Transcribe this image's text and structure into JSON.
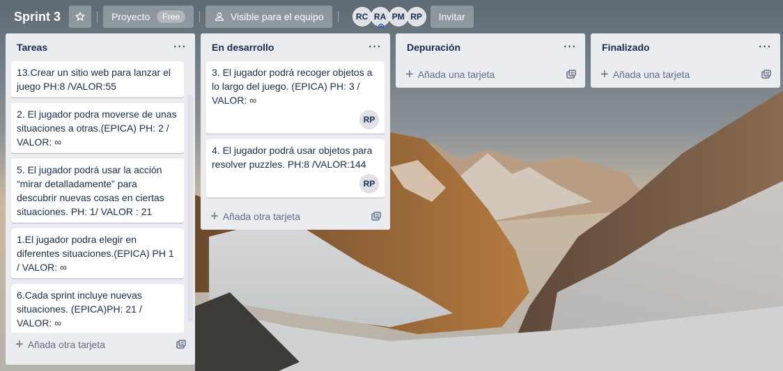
{
  "board": {
    "title": "Sprint 3",
    "workspace_label": "Proyecto",
    "workspace_badge": "Free",
    "visibility_label": "Visible para el equipo",
    "members": [
      "RC",
      "RA",
      "PM",
      "RP"
    ],
    "invite_label": "Invitar"
  },
  "lists": [
    {
      "title": "Tareas",
      "cards": [
        {
          "text": "13.Crear un sitio web para lanzar el juego PH:8 /VALOR:55"
        },
        {
          "text": "2. El jugador podra moverse de unas situaciones a otras.(EPICA) PH: 2 / VALOR: ∞"
        },
        {
          "text": "5. El jugador podrá usar la acción “mirar detalladamente” para descubrir nuevas cosas en ciertas situaciones. PH: 1/ VALOR : 21"
        },
        {
          "text": "1.El jugador podra elegir en diferentes situaciones.(EPICA) PH 1 / VALOR: ∞"
        },
        {
          "text": "6.Cada sprint incluye nuevas situaciones. (EPICA)PH: 21 / VALOR: ∞"
        }
      ],
      "add_label": "Añada otra tarjeta"
    },
    {
      "title": "En desarrollo",
      "cards": [
        {
          "text": "3. El jugador podrá recoger objetos a lo largo del juego. (EPICA) PH: 3 / VALOR: ∞",
          "member": "RP"
        },
        {
          "text": "4. El jugador podrá usar objetos para resolver puzzles. PH:8 /VALOR:144",
          "member": "RP"
        }
      ],
      "add_label": "Añada otra tarjeta"
    },
    {
      "title": "Depuración",
      "cards": [],
      "add_label": "Añada una tarjeta"
    },
    {
      "title": "Finalizado",
      "cards": [],
      "add_label": "Añada una tarjeta"
    }
  ],
  "icons": {
    "star": "star-icon",
    "visibility": "team-icon",
    "list_menu": "ellipsis-icon",
    "add": "plus-icon",
    "template": "card-template-icon"
  },
  "colors": {
    "list_bg": "#ebecf0",
    "card_bg": "#ffffff",
    "text": "#172b4d",
    "muted": "#5e6c84"
  }
}
